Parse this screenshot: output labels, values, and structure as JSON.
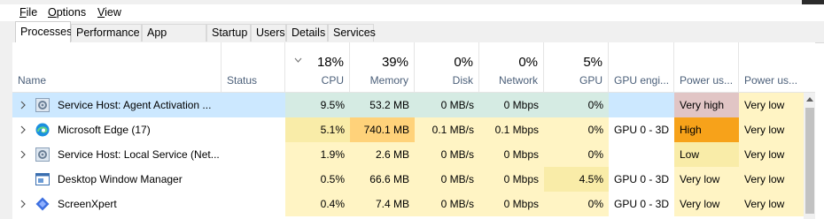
{
  "menu": [
    {
      "label": "File",
      "accel": "F"
    },
    {
      "label": "Options",
      "accel": "O"
    },
    {
      "label": "View",
      "accel": "V"
    }
  ],
  "tabs": [
    {
      "label": "Processes",
      "active": true
    },
    {
      "label": "Performance"
    },
    {
      "label": "App history"
    },
    {
      "label": "Startup"
    },
    {
      "label": "Users"
    },
    {
      "label": "Details"
    },
    {
      "label": "Services"
    }
  ],
  "columns": {
    "name": "Name",
    "status": "Status",
    "cpu": {
      "pct": "18%",
      "label": "CPU"
    },
    "memory": {
      "pct": "39%",
      "label": "Memory"
    },
    "disk": {
      "pct": "0%",
      "label": "Disk"
    },
    "network": {
      "pct": "0%",
      "label": "Network"
    },
    "gpu": {
      "pct": "5%",
      "label": "GPU"
    },
    "gpu_engine": "GPU engi...",
    "power_usage": "Power us...",
    "power_usage_trend": "Power us..."
  },
  "rows": [
    {
      "name": "Service Host: Agent Activation ...",
      "icon": "gear-icon",
      "expandable": true,
      "selected": true,
      "cpu": "9.5%",
      "memory": "53.2 MB",
      "disk": "0 MB/s",
      "network": "0 Mbps",
      "gpu": "0%",
      "gpu_engine": "",
      "power": "Very high",
      "power_trend": "Very low"
    },
    {
      "name": "Microsoft Edge (17)",
      "icon": "edge-icon",
      "expandable": true,
      "cpu": "5.1%",
      "memory": "740.1 MB",
      "disk": "0.1 MB/s",
      "network": "0.1 Mbps",
      "gpu": "0%",
      "gpu_engine": "GPU 0 - 3D",
      "power": "High",
      "power_trend": "Very low"
    },
    {
      "name": "Service Host: Local Service (Net...",
      "icon": "gear-icon",
      "expandable": true,
      "cpu": "1.9%",
      "memory": "2.6 MB",
      "disk": "0 MB/s",
      "network": "0 Mbps",
      "gpu": "0%",
      "gpu_engine": "",
      "power": "Low",
      "power_trend": "Very low"
    },
    {
      "name": "Desktop Window Manager",
      "icon": "window-manager-icon",
      "expandable": false,
      "cpu": "0.5%",
      "memory": "66.6 MB",
      "disk": "0 MB/s",
      "network": "0 Mbps",
      "gpu": "4.5%",
      "gpu_engine": "GPU 0 - 3D",
      "power": "Very low",
      "power_trend": "Very low"
    },
    {
      "name": "ScreenXpert",
      "icon": "screenxpert-icon",
      "expandable": true,
      "cpu": "0.4%",
      "memory": "7.4 MB",
      "disk": "0 MB/s",
      "network": "0 Mbps",
      "gpu": "0%",
      "gpu_engine": "GPU 0 - 3D",
      "power": "Very low",
      "power_trend": "Very low"
    }
  ],
  "colors": {
    "selected_row": "#cce8ff",
    "heat_light": "#fff4c4",
    "heat_mid": "#f9eca8",
    "heat_strong": "#ffd27a",
    "power_very_high": "#e1c5c5",
    "power_high": "#f7a21a",
    "power_low": "#f9eca8",
    "header_label": "#4c607a"
  }
}
